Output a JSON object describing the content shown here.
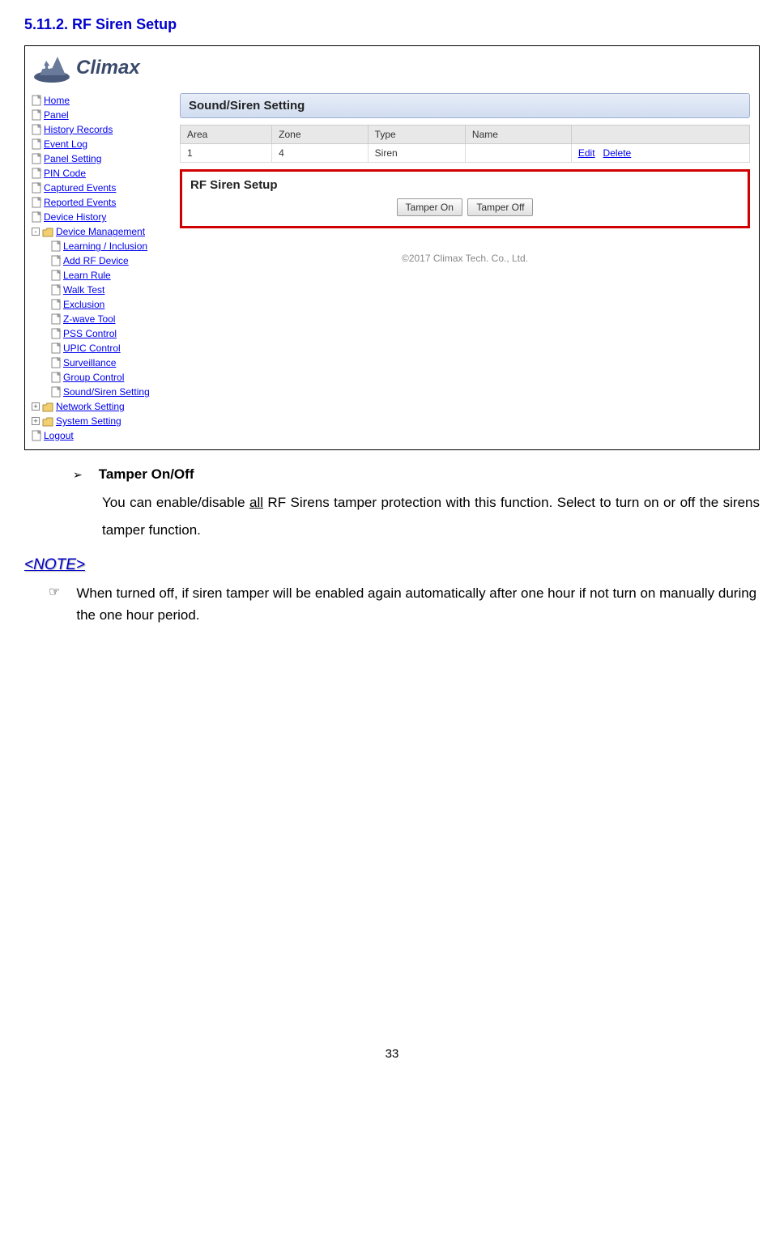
{
  "section": {
    "title": "5.11.2. RF Siren Setup"
  },
  "logo": {
    "text": "Climax"
  },
  "sidebar": {
    "items": [
      {
        "label": "Home",
        "type": "file"
      },
      {
        "label": "Panel",
        "type": "file"
      },
      {
        "label": "History Records",
        "type": "file"
      },
      {
        "label": "Event Log",
        "type": "file"
      },
      {
        "label": "Panel Setting",
        "type": "file"
      },
      {
        "label": "PIN Code",
        "type": "file"
      },
      {
        "label": "Captured Events",
        "type": "file"
      },
      {
        "label": "Reported Events",
        "type": "file"
      },
      {
        "label": "Device History",
        "type": "file"
      }
    ],
    "device_mgmt": {
      "label": "Device Management",
      "children": [
        {
          "label": "Learning / Inclusion"
        },
        {
          "label": "Add RF Device"
        },
        {
          "label": "Learn Rule"
        },
        {
          "label": "Walk Test"
        },
        {
          "label": "Exclusion"
        },
        {
          "label": "Z-wave Tool"
        },
        {
          "label": "PSS Control"
        },
        {
          "label": "UPIC Control"
        },
        {
          "label": "Surveillance"
        },
        {
          "label": "Group Control"
        },
        {
          "label": "Sound/Siren Setting"
        }
      ]
    },
    "bottom": [
      {
        "label": "Network Setting",
        "type": "folder"
      },
      {
        "label": "System Setting",
        "type": "folder"
      },
      {
        "label": "Logout",
        "type": "file"
      }
    ]
  },
  "panel": {
    "header": "Sound/Siren Setting",
    "table": {
      "headers": [
        "Area",
        "Zone",
        "Type",
        "Name",
        ""
      ],
      "row": {
        "area": "1",
        "zone": "4",
        "type": "Siren",
        "name": "",
        "actions": {
          "edit": "Edit",
          "delete": "Delete"
        }
      }
    },
    "rf": {
      "title": "RF Siren Setup",
      "btn_on": "Tamper On",
      "btn_off": "Tamper Off"
    },
    "copyright": "©2017 Climax Tech. Co., Ltd."
  },
  "doc": {
    "bullet_title": "Tamper On/Off",
    "bullet_text_1": "You can enable/disable ",
    "bullet_text_all": "all",
    "bullet_text_2": " RF Sirens tamper protection with this function. Select to turn on or off the sirens tamper function.",
    "note_label": "<NOTE>",
    "note_text": "When turned off, if siren tamper will be enabled again automatically after one hour if not turn on manually during the one hour period."
  },
  "page_number": "33"
}
